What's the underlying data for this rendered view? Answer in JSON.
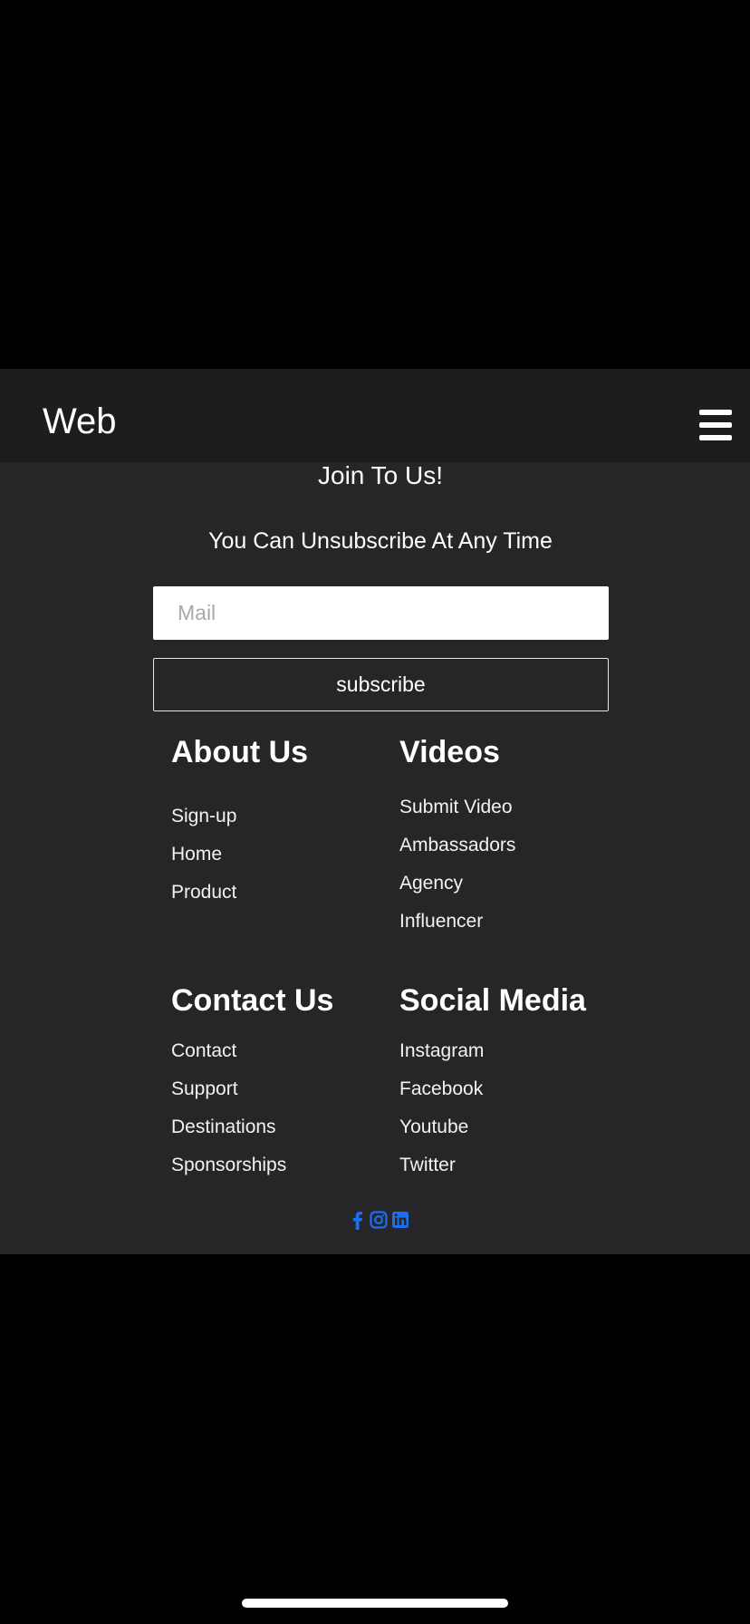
{
  "navbar": {
    "brand": "Web",
    "menu_icon": "hamburger-menu-icon"
  },
  "newsletter": {
    "title": "Join To Us!",
    "subtitle": "You Can Unsubscribe At Any Time",
    "mail_placeholder": "Mail",
    "mail_value": "",
    "subscribe_label": "subscribe"
  },
  "footer": {
    "columns": [
      {
        "heading": "About Us",
        "links": [
          "Sign-up",
          "Home",
          "Product"
        ]
      },
      {
        "heading": "Videos",
        "links": [
          "Submit Video",
          "Ambassadors",
          "Agency",
          "Influencer"
        ]
      },
      {
        "heading": "Contact Us",
        "links": [
          "Contact",
          "Support",
          "Destinations",
          "Sponsorships"
        ]
      },
      {
        "heading": "Social Media",
        "links": [
          "Instagram",
          "Facebook",
          "Youtube",
          "Twitter"
        ]
      }
    ],
    "social_icons": [
      "facebook-icon",
      "instagram-icon",
      "linkedin-icon"
    ],
    "social_icon_color": "#1a6ef5"
  },
  "colors": {
    "page_background": "#262528",
    "navbar_background": "#1d1c1e",
    "text": "#ffffff"
  }
}
